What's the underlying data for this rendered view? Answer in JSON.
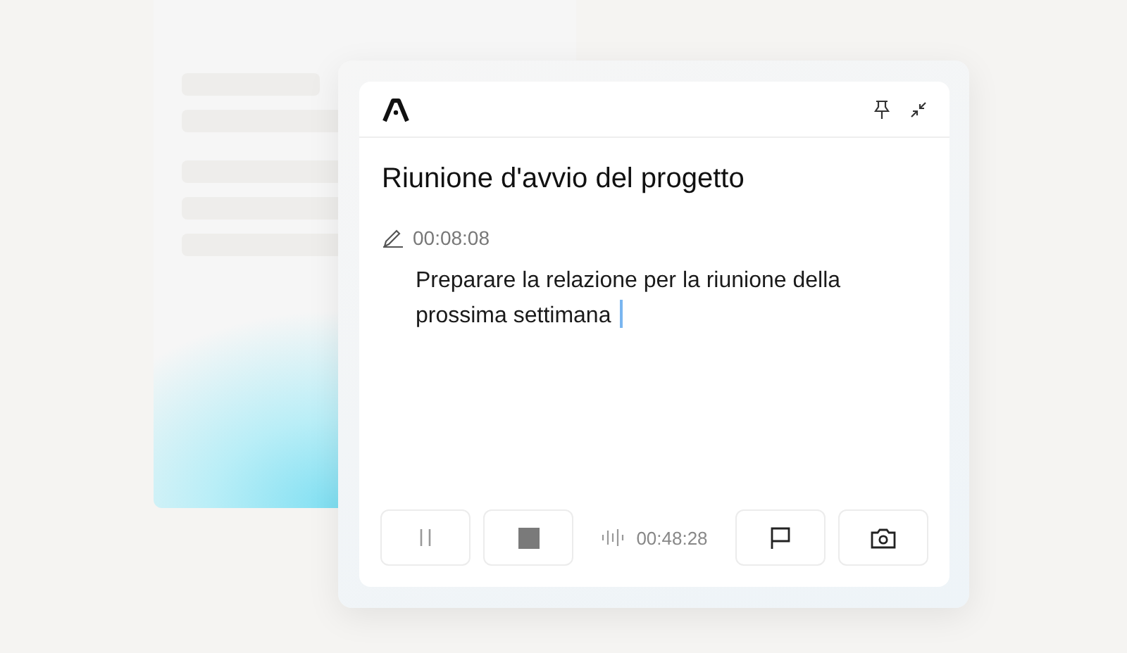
{
  "note": {
    "title": "Riunione d'avvio del progetto",
    "timestamp": "00:08:08",
    "text": "Preparare la relazione per la riunione della prossima settimana"
  },
  "recorder": {
    "elapsed": "00:48:28",
    "left_buttons": [
      {
        "kind": "pause"
      },
      {
        "kind": "stop"
      }
    ],
    "right_buttons": [
      {
        "kind": "flag"
      },
      {
        "kind": "camera"
      }
    ]
  }
}
